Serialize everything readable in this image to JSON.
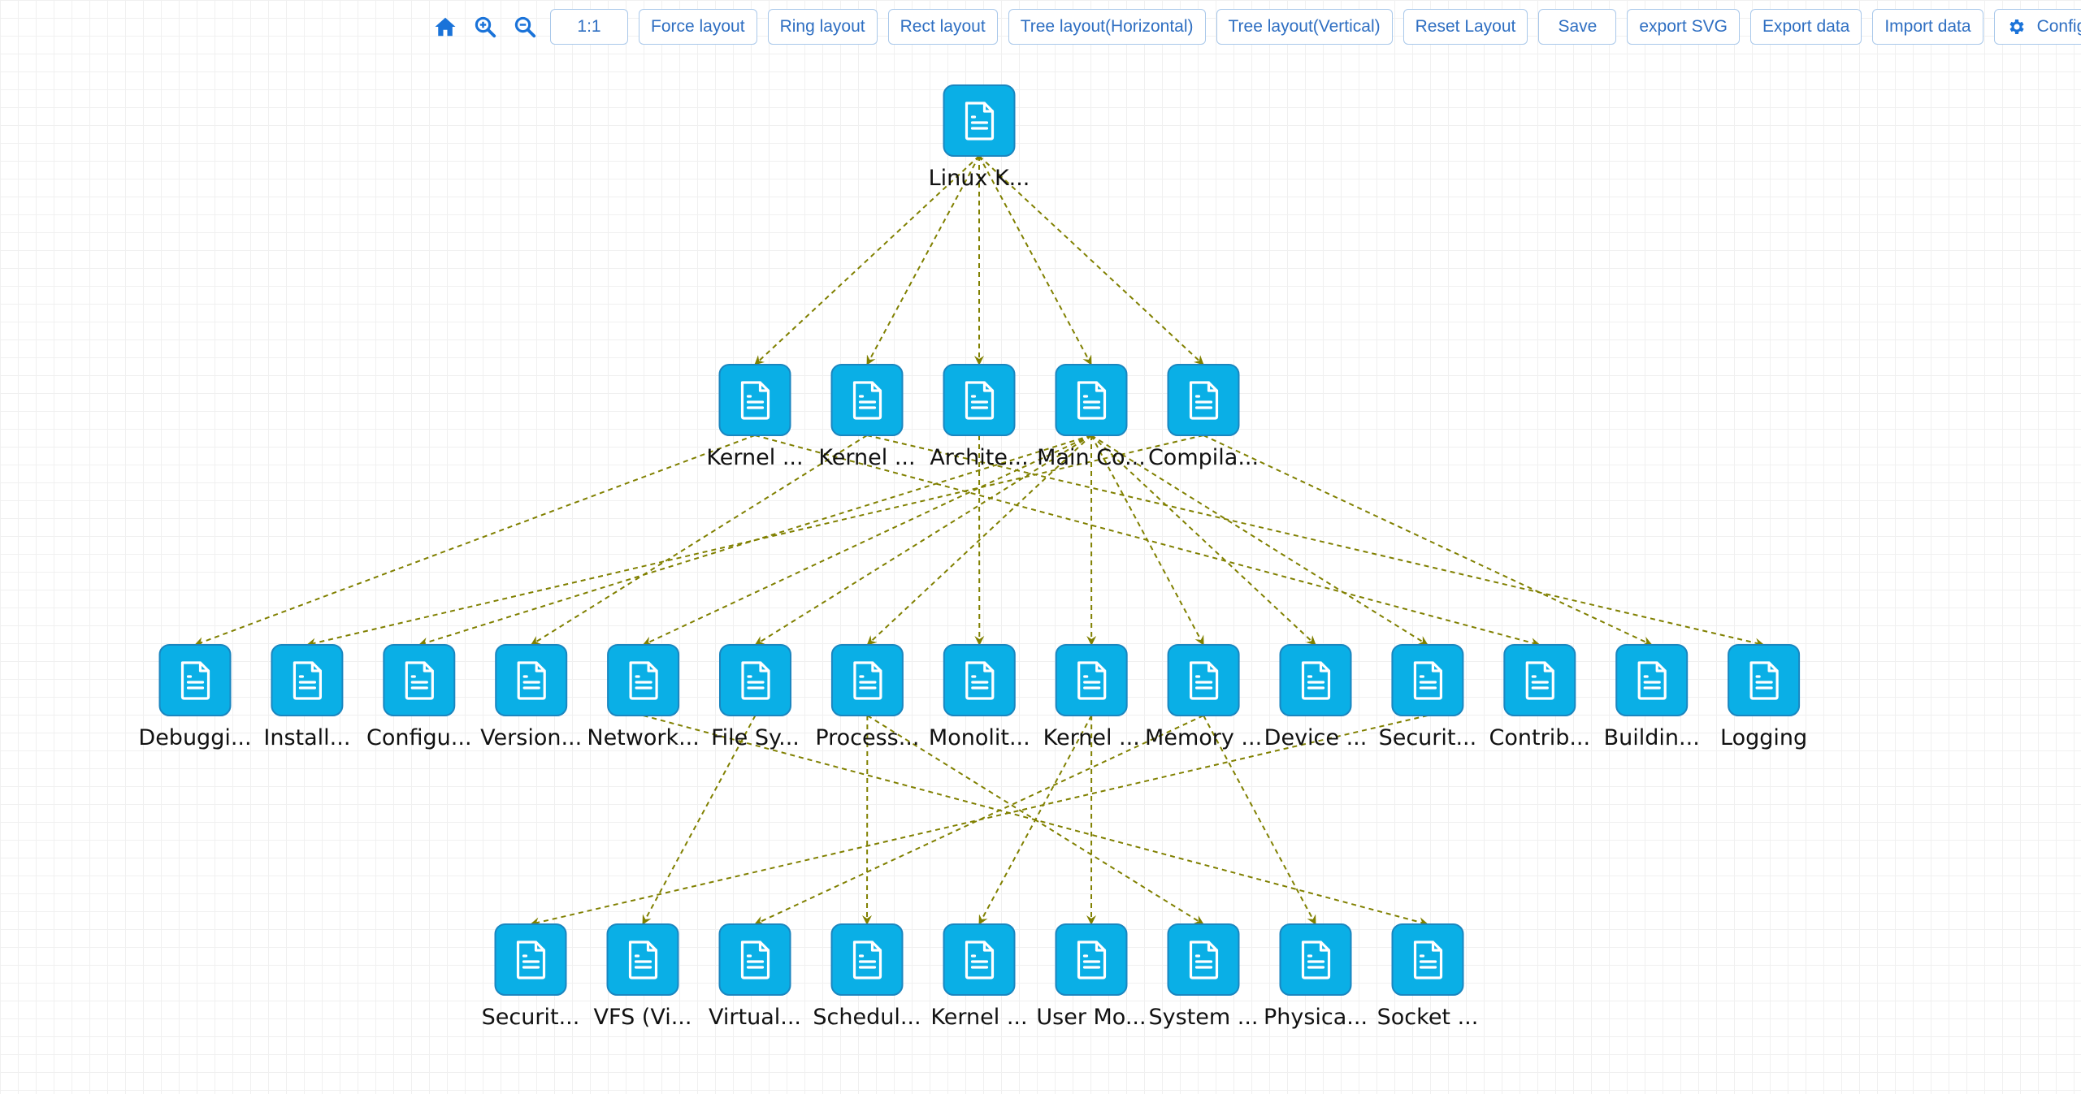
{
  "toolbar": {
    "icons": [
      {
        "name": "home-icon"
      },
      {
        "name": "zoom-in-icon"
      },
      {
        "name": "zoom-out-icon"
      }
    ],
    "buttons": [
      {
        "id": "zoom-reset",
        "label": "1:1"
      },
      {
        "id": "force-layout",
        "label": "Force layout"
      },
      {
        "id": "ring-layout",
        "label": "Ring layout"
      },
      {
        "id": "rect-layout",
        "label": "Rect layout"
      },
      {
        "id": "tree-layout-horizontal",
        "label": "Tree layout(Horizontal)"
      },
      {
        "id": "tree-layout-vertical",
        "label": "Tree layout(Vertical)"
      },
      {
        "id": "reset-layout",
        "label": "Reset Layout"
      },
      {
        "id": "save",
        "label": "Save"
      },
      {
        "id": "export-svg",
        "label": "export SVG"
      },
      {
        "id": "export-data",
        "label": "Export data"
      },
      {
        "id": "import-data",
        "label": "Import data"
      },
      {
        "id": "config",
        "label": "Config",
        "icon": "gear-icon"
      }
    ]
  },
  "colors": {
    "accent": "#1a73d9",
    "node_fill": "#0aafe6",
    "node_stroke": "#1a86c0",
    "edge": "#808000",
    "button_text": "#2f6fc2",
    "button_border": "#a9c8ea"
  },
  "graph": {
    "node_icon": "document-icon",
    "nodes": [
      {
        "id": "root",
        "label": "Linux K...",
        "level": 0,
        "col": 0
      },
      {
        "id": "l1_kernel_a",
        "label": "Kernel ...",
        "level": 1,
        "col": 0
      },
      {
        "id": "l1_kernel_b",
        "label": "Kernel ...",
        "level": 1,
        "col": 1
      },
      {
        "id": "l1_archite",
        "label": "Archite...",
        "level": 1,
        "col": 2
      },
      {
        "id": "l1_mainco",
        "label": "Main Co...",
        "level": 1,
        "col": 3
      },
      {
        "id": "l1_compila",
        "label": "Compila...",
        "level": 1,
        "col": 4
      },
      {
        "id": "l2_debuggi",
        "label": "Debuggi...",
        "level": 2,
        "col": 0
      },
      {
        "id": "l2_install",
        "label": "Install...",
        "level": 2,
        "col": 1
      },
      {
        "id": "l2_configu",
        "label": "Configu...",
        "level": 2,
        "col": 2
      },
      {
        "id": "l2_version",
        "label": "Version...",
        "level": 2,
        "col": 3
      },
      {
        "id": "l2_network",
        "label": "Network...",
        "level": 2,
        "col": 4
      },
      {
        "id": "l2_filesy",
        "label": "File Sy...",
        "level": 2,
        "col": 5
      },
      {
        "id": "l2_process",
        "label": "Process...",
        "level": 2,
        "col": 6
      },
      {
        "id": "l2_monolit",
        "label": "Monolit...",
        "level": 2,
        "col": 7
      },
      {
        "id": "l2_kernel",
        "label": "Kernel ...",
        "level": 2,
        "col": 8
      },
      {
        "id": "l2_memory",
        "label": "Memory ...",
        "level": 2,
        "col": 9
      },
      {
        "id": "l2_device",
        "label": "Device ...",
        "level": 2,
        "col": 10
      },
      {
        "id": "l2_securit",
        "label": "Securit...",
        "level": 2,
        "col": 11
      },
      {
        "id": "l2_contrib",
        "label": "Contrib...",
        "level": 2,
        "col": 12
      },
      {
        "id": "l2_buildin",
        "label": "Buildin...",
        "level": 2,
        "col": 13
      },
      {
        "id": "l2_logging",
        "label": "Logging",
        "level": 2,
        "col": 14
      },
      {
        "id": "l3_securit",
        "label": "Securit...",
        "level": 3,
        "col": 0
      },
      {
        "id": "l3_vfs",
        "label": "VFS (Vi...",
        "level": 3,
        "col": 1
      },
      {
        "id": "l3_virtual",
        "label": "Virtual...",
        "level": 3,
        "col": 2
      },
      {
        "id": "l3_schedul",
        "label": "Schedul...",
        "level": 3,
        "col": 3
      },
      {
        "id": "l3_kernel",
        "label": "Kernel ...",
        "level": 3,
        "col": 4
      },
      {
        "id": "l3_usermo",
        "label": "User Mo...",
        "level": 3,
        "col": 5
      },
      {
        "id": "l3_system",
        "label": "System ...",
        "level": 3,
        "col": 6
      },
      {
        "id": "l3_physica",
        "label": "Physica...",
        "level": 3,
        "col": 7
      },
      {
        "id": "l3_socket",
        "label": "Socket ...",
        "level": 3,
        "col": 8
      }
    ],
    "edges": [
      [
        "root",
        "l1_kernel_a"
      ],
      [
        "root",
        "l1_kernel_b"
      ],
      [
        "root",
        "l1_archite"
      ],
      [
        "root",
        "l1_mainco"
      ],
      [
        "root",
        "l1_compila"
      ],
      [
        "l1_kernel_a",
        "l2_debuggi"
      ],
      [
        "l1_kernel_a",
        "l2_contrib"
      ],
      [
        "l1_kernel_b",
        "l2_version"
      ],
      [
        "l1_kernel_b",
        "l2_logging"
      ],
      [
        "l1_archite",
        "l2_monolit"
      ],
      [
        "l1_mainco",
        "l2_configu"
      ],
      [
        "l1_mainco",
        "l2_network"
      ],
      [
        "l1_mainco",
        "l2_filesy"
      ],
      [
        "l1_mainco",
        "l2_process"
      ],
      [
        "l1_mainco",
        "l2_kernel"
      ],
      [
        "l1_mainco",
        "l2_memory"
      ],
      [
        "l1_mainco",
        "l2_device"
      ],
      [
        "l1_mainco",
        "l2_securit"
      ],
      [
        "l1_compila",
        "l2_install"
      ],
      [
        "l1_compila",
        "l2_buildin"
      ],
      [
        "l2_securit",
        "l3_securit"
      ],
      [
        "l2_filesy",
        "l3_vfs"
      ],
      [
        "l2_memory",
        "l3_virtual"
      ],
      [
        "l2_process",
        "l3_schedul"
      ],
      [
        "l2_kernel",
        "l3_kernel"
      ],
      [
        "l2_kernel",
        "l3_usermo"
      ],
      [
        "l2_process",
        "l3_system"
      ],
      [
        "l2_memory",
        "l3_physica"
      ],
      [
        "l2_network",
        "l3_socket"
      ]
    ]
  }
}
